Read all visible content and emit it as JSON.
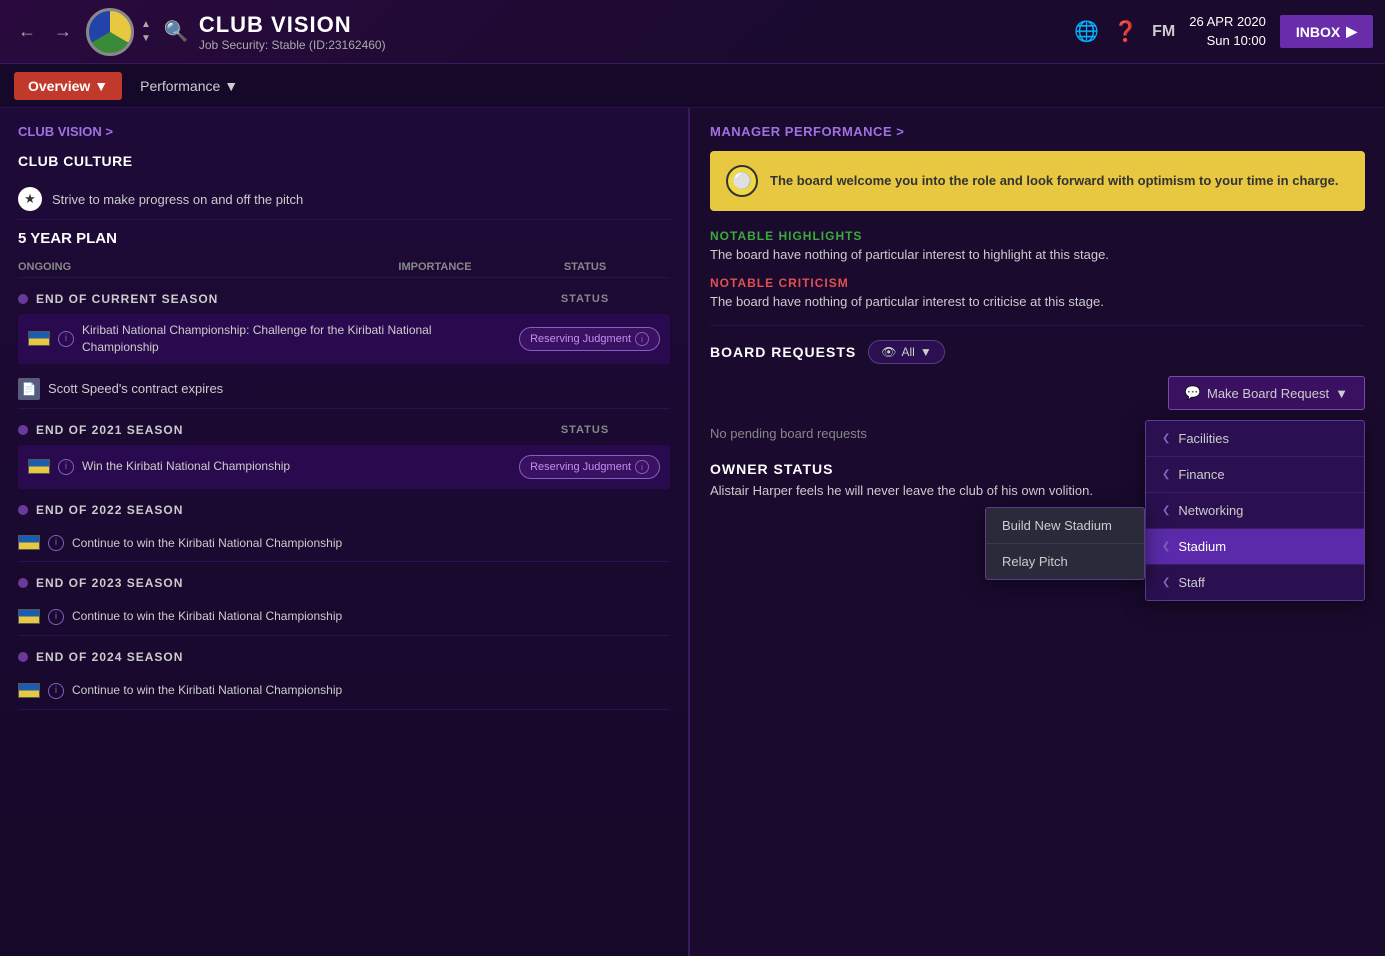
{
  "topbar": {
    "title": "CLUB VISION",
    "subtitle": "Job Security: Stable (ID:23162460)",
    "date_line1": "26 APR 2020",
    "date_line2": "Sun 10:00",
    "inbox_label": "INBOX"
  },
  "subnav": {
    "overview_label": "Overview",
    "performance_label": "Performance"
  },
  "left": {
    "club_vision_link": "CLUB VISION >",
    "club_culture_title": "CLUB CULTURE",
    "culture_item": "Strive to make progress on and off the pitch",
    "five_year_title": "5 YEAR PLAN",
    "col_ongoing": "ONGOING",
    "col_importance": "IMPORTANCE",
    "col_status": "STATUS",
    "seasons": [
      {
        "label": "END OF CURRENT SEASON",
        "items": [
          {
            "text": "Kiribati National Championship: Challenge for the Kiribati National Championship",
            "status": "Reserving Judgment",
            "type": "badge"
          },
          {
            "text": "Scott Speed's contract expires",
            "type": "contract"
          }
        ]
      },
      {
        "label": "END OF 2021 SEASON",
        "items": [
          {
            "text": "Win the Kiribati National Championship",
            "status": "Reserving Judgment",
            "type": "badge"
          }
        ]
      },
      {
        "label": "END OF 2022 SEASON",
        "items": [
          {
            "text": "Continue to win the Kiribati National Championship",
            "type": "plain"
          }
        ]
      },
      {
        "label": "END OF 2023 SEASON",
        "items": [
          {
            "text": "Continue to win the Kiribati National Championship",
            "type": "plain"
          }
        ]
      },
      {
        "label": "END OF 2024 SEASON",
        "items": [
          {
            "text": "Continue to win the Kiribati National Championship",
            "type": "plain"
          }
        ]
      }
    ]
  },
  "right": {
    "manager_perf_title": "MANAGER PERFORMANCE >",
    "welcome_text": "The board welcome you into the role and look forward with optimism to your time in charge.",
    "highlights_title": "NOTABLE HIGHLIGHTS",
    "highlights_text": "The board have nothing of particular interest to highlight at this stage.",
    "criticism_title": "NOTABLE CRITICISM",
    "criticism_text": "The board have nothing of particular interest to criticise at this stage.",
    "board_requests_title": "BOARD REQUESTS",
    "filter_label": "All",
    "make_request_label": "Make Board Request",
    "no_requests_text": "No pending board requests",
    "dropdown_items": [
      {
        "label": "Facilities",
        "active": false
      },
      {
        "label": "Finance",
        "active": false
      },
      {
        "label": "Networking",
        "active": false
      },
      {
        "label": "Stadium",
        "active": true
      },
      {
        "label": "Staff",
        "active": false
      }
    ],
    "sub_dropdown_items": [
      {
        "label": "Build New Stadium"
      },
      {
        "label": "Relay Pitch"
      }
    ],
    "owner_status_title": "OWNER STATUS",
    "owner_status_text": "Alistair Harper feels he will never leave the club of his own volition."
  }
}
